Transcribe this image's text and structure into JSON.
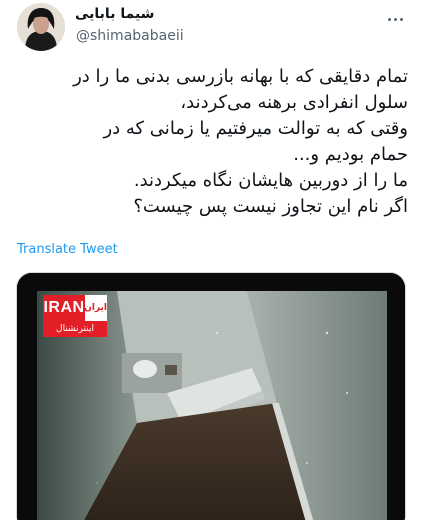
{
  "author": {
    "display_name": "شیما بابایی",
    "handle": "@shimababaeii"
  },
  "tweet": {
    "lines": [
      "تمام دقایقی که با بهانه بازرسی بدنی ما را در",
      "سلول انفرادی برهنه می‌کردند،",
      "وقتی که به توالت میرفتیم یا زمانی که در",
      "حمام بودیم و...",
      "ما را  از دوربین هایشان نگاه میکردند.",
      "اگر نام این تجاوز نیست پس چیست؟"
    ],
    "translate_label": "Translate Tweet"
  },
  "media": {
    "logo_main": "ایران",
    "logo_iran": "IRAN",
    "logo_sub": "اینترنشنال",
    "logo_color": "#e21f26"
  },
  "icons": {
    "more": "more-options-icon"
  }
}
